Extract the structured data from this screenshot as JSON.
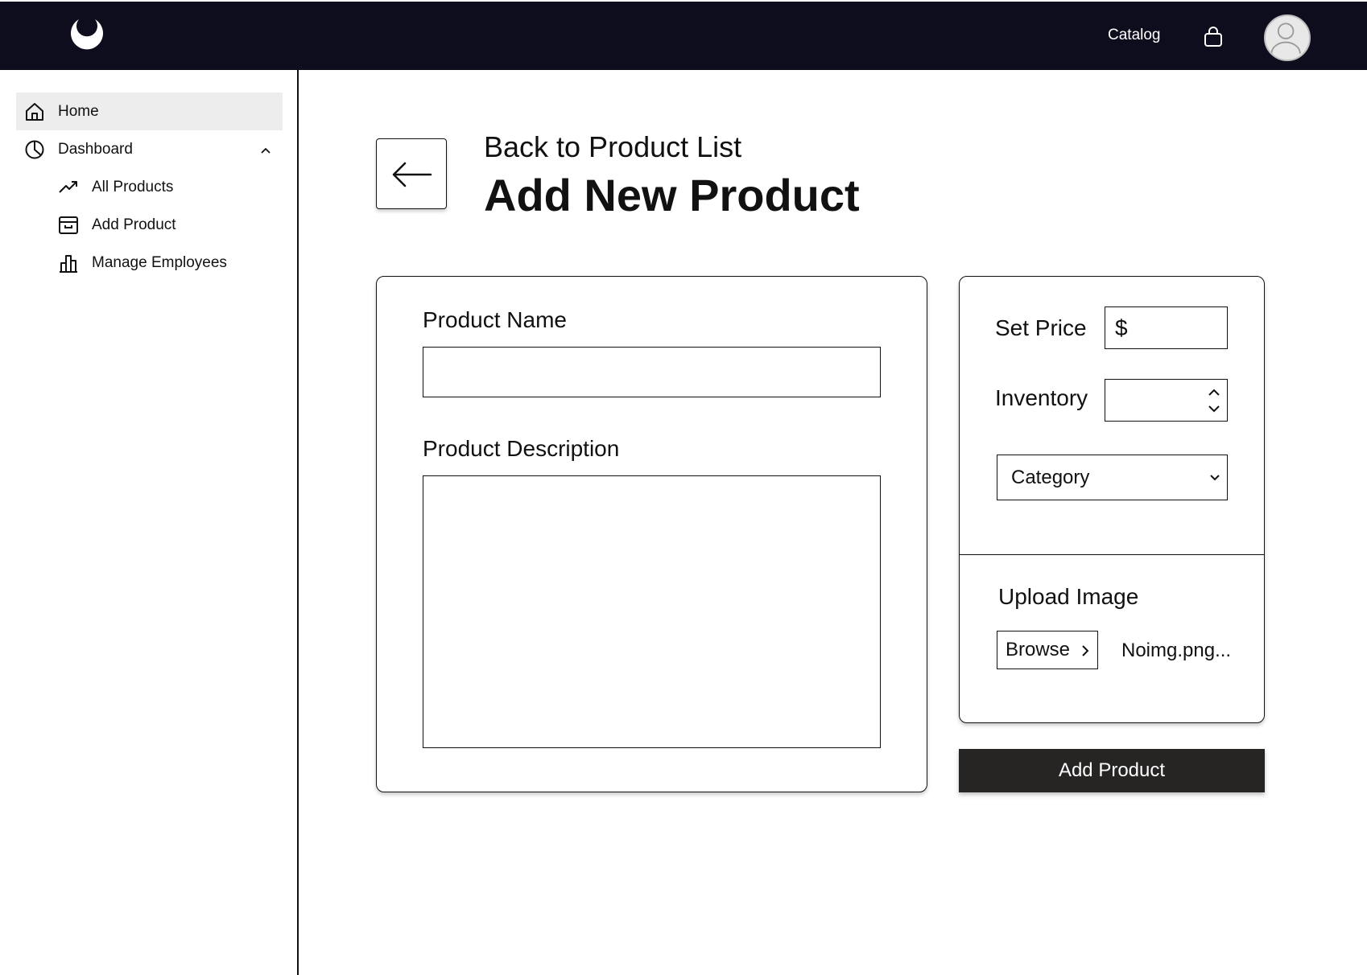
{
  "header": {
    "logo": "crescent-logo",
    "catalog_label": "Catalog",
    "cart_icon": "shopping-bag-icon",
    "avatar_icon": "user-avatar-icon"
  },
  "sidebar": {
    "items": [
      {
        "label": "Home",
        "icon": "home-icon",
        "active": true
      },
      {
        "label": "Dashboard",
        "icon": "pie-chart-icon",
        "expanded": true
      },
      {
        "label": "All Products",
        "icon": "trending-up-icon"
      },
      {
        "label": "Add Product",
        "icon": "archive-box-icon"
      },
      {
        "label": "Manage Employees",
        "icon": "bar-chart-icon"
      }
    ]
  },
  "page": {
    "back_label": "Back to Product List",
    "title": "Add New Product"
  },
  "form": {
    "name_label": "Product Name",
    "name_value": "",
    "description_label": "Product Description",
    "description_value": "",
    "price_label": "Set Price",
    "price_prefix": "$",
    "inventory_label": "Inventory",
    "category_selected": "Category",
    "upload_label": "Upload Image",
    "browse_label": "Browse",
    "file_name": "Noimg.png...",
    "submit_label": "Add Product"
  },
  "colors": {
    "topbar": "#0e0d1e",
    "active_item": "#ededed",
    "primary_button": "#272424"
  }
}
